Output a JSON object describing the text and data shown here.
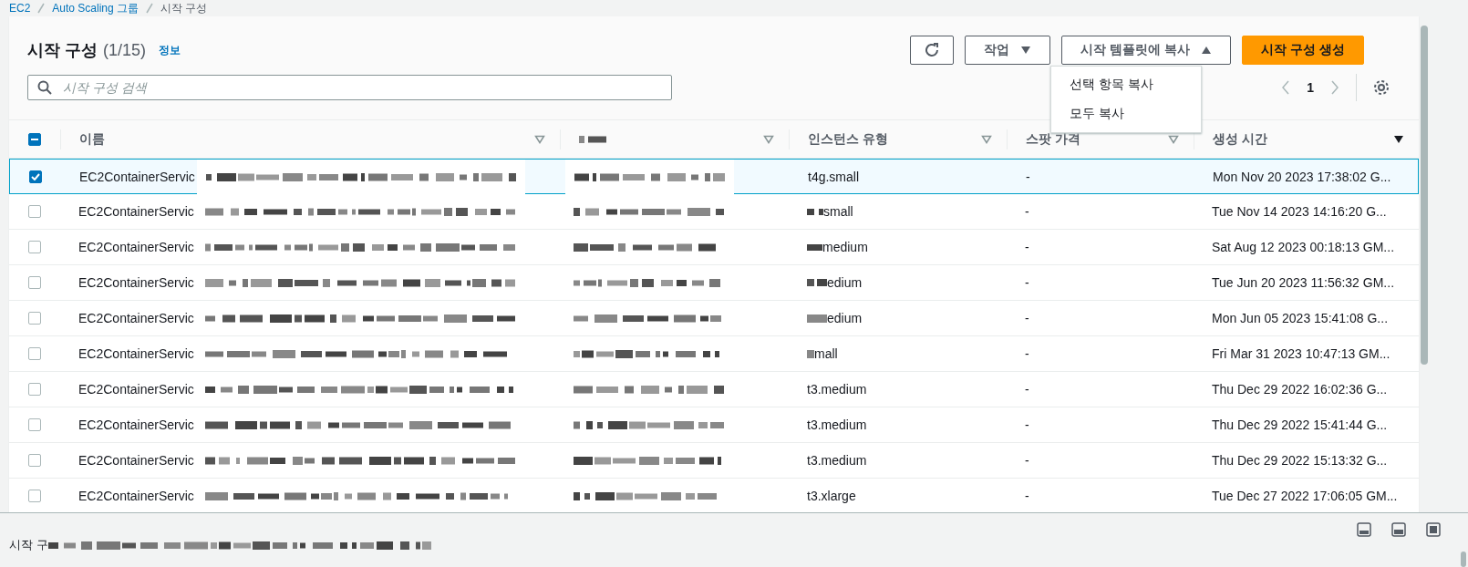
{
  "breadcrumbs": [
    {
      "label": "EC2"
    },
    {
      "label": "Auto Scaling 그룹"
    },
    {
      "label": "시작 구성"
    }
  ],
  "header": {
    "title": "시작 구성",
    "count": "(1/15)",
    "info_link": "정보"
  },
  "buttons": [
    {
      "kind": "icon"
    },
    {
      "kind": "dropdown",
      "label": "작업",
      "expanded": false
    },
    {
      "kind": "dropdown",
      "label": "시작 템플릿에 복사",
      "expanded": true
    },
    {
      "kind": "primary",
      "label": "시작 구성 생성"
    }
  ],
  "dropdown_menu": [
    {
      "label": "선택 항목 복사"
    },
    {
      "label": "모두 복사"
    }
  ],
  "search": {
    "placeholder": "시작 구성 검색"
  },
  "pagination": {
    "page": "1"
  },
  "table": {
    "select_all_indeterminate": true,
    "columns": [
      {
        "label": "이름",
        "sorted": false
      },
      {
        "sorted": false
      },
      {
        "label": "인스턴스 유형",
        "sorted": false
      },
      {
        "label": "스팟 가격",
        "sorted": false
      },
      {
        "label": "생성 시간",
        "sorted": true
      }
    ],
    "rows": [
      {
        "selected": true,
        "name": "EC2ContainerServic",
        "instance_type": "t4g.small",
        "type_masked": false,
        "spot_price": "-",
        "created": "Mon Nov 20 2023 17:38:02 G..."
      },
      {
        "selected": false,
        "name": "EC2ContainerServic",
        "instance_type": "small",
        "type_masked": true,
        "spot_price": "-",
        "created": "Tue Nov 14 2023 14:16:20 G..."
      },
      {
        "selected": false,
        "name": "EC2ContainerServic",
        "instance_type": "medium",
        "type_masked": true,
        "spot_price": "-",
        "created": "Sat Aug 12 2023 00:18:13 GM..."
      },
      {
        "selected": false,
        "name": "EC2ContainerServic",
        "instance_type": "edium",
        "type_masked": true,
        "spot_price": "-",
        "created": "Tue Jun 20 2023 11:56:32 GM..."
      },
      {
        "selected": false,
        "name": "EC2ContainerServic",
        "instance_type": "edium",
        "type_masked": true,
        "spot_price": "-",
        "created": "Mon Jun 05 2023 15:41:08 G..."
      },
      {
        "selected": false,
        "name": "EC2ContainerServic",
        "instance_type": "mall",
        "type_masked": true,
        "spot_price": "-",
        "created": "Fri Mar 31 2023 10:47:13 GM..."
      },
      {
        "selected": false,
        "name": "EC2ContainerServic",
        "instance_type": "t3.medium",
        "type_masked": false,
        "spot_price": "-",
        "created": "Thu Dec 29 2022 16:02:36 G..."
      },
      {
        "selected": false,
        "name": "EC2ContainerServic",
        "instance_type": "t3.medium",
        "type_masked": false,
        "spot_price": "-",
        "created": "Thu Dec 29 2022 15:41:44 G..."
      },
      {
        "selected": false,
        "name": "EC2ContainerServic",
        "instance_type": "t3.medium",
        "type_masked": false,
        "spot_price": "-",
        "created": "Thu Dec 29 2022 15:13:32 G..."
      },
      {
        "selected": false,
        "name": "EC2ContainerServic",
        "instance_type": "t3.xlarge",
        "type_masked": false,
        "spot_price": "-",
        "created": "Tue Dec 27 2022 17:06:05 GM..."
      }
    ]
  },
  "split_panel": {
    "text": "시작 구"
  }
}
